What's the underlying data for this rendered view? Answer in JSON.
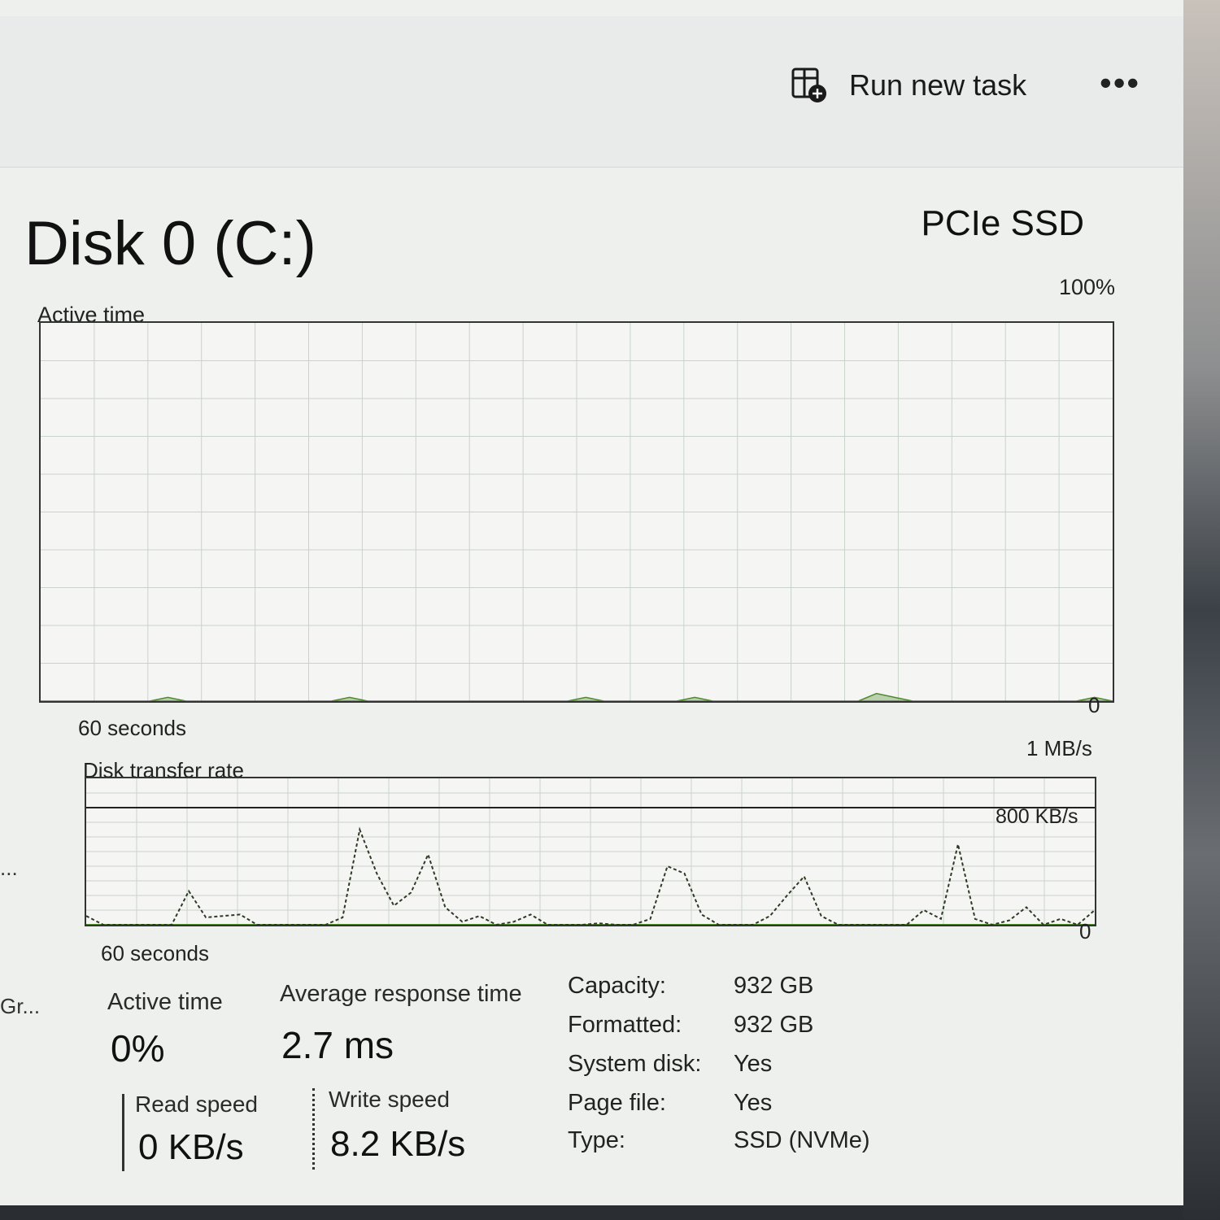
{
  "command_bar": {
    "run_task_label": "Run new task",
    "more_label": "•••"
  },
  "sidebar": {
    "ellipsis_text": "...",
    "gpu_label": "Gr..."
  },
  "disk": {
    "title": "Disk 0 (C:)",
    "model": "PCIe SSD"
  },
  "active_time_graph": {
    "label": "Active time",
    "max_label": "100%",
    "min_label": "0",
    "time_label": "60 seconds",
    "accent_color": "#4f8a2c"
  },
  "transfer_graph": {
    "label": "Disk transfer rate",
    "max_label": "1 MB/s",
    "ref_label": "800 KB/s",
    "min_label": "0",
    "time_label": "60 seconds",
    "accent_color": "#4f8a2c"
  },
  "stats": {
    "active_time_label": "Active time",
    "active_time_value": "0%",
    "avg_response_label": "Average response time",
    "avg_response_value": "2.7 ms",
    "read_speed_label": "Read speed",
    "read_speed_value": "0 KB/s",
    "write_speed_label": "Write speed",
    "write_speed_value": "8.2 KB/s"
  },
  "properties": [
    {
      "key": "Capacity:",
      "value": "932 GB"
    },
    {
      "key": "Formatted:",
      "value": "932 GB"
    },
    {
      "key": "System disk:",
      "value": "Yes"
    },
    {
      "key": "Page file:",
      "value": "Yes"
    },
    {
      "key": "Type:",
      "value": "SSD (NVMe)"
    }
  ],
  "chart_data": [
    {
      "type": "area",
      "title": "Active time",
      "xlabel": "60 seconds",
      "ylim": [
        0,
        100
      ],
      "unit": "%",
      "grid": true,
      "series": [
        {
          "values": [
            0,
            0,
            0,
            0,
            0,
            0,
            0,
            1,
            0,
            0,
            0,
            0,
            0,
            0,
            0,
            0,
            0,
            1,
            0,
            0,
            0,
            0,
            0,
            0,
            0,
            0,
            0,
            0,
            0,
            0,
            1,
            0,
            0,
            0,
            0,
            0,
            1,
            0,
            0,
            0,
            0,
            0,
            0,
            0,
            0,
            0,
            2,
            1,
            0,
            0,
            0,
            0,
            0,
            0,
            0,
            0,
            0,
            0,
            1,
            0
          ]
        }
      ]
    },
    {
      "type": "line",
      "title": "Disk transfer rate",
      "xlabel": "60 seconds",
      "ylim": [
        0,
        1000
      ],
      "unit": "KB/s",
      "reference_line": 800,
      "grid": true,
      "series": [
        {
          "name": "Read speed",
          "values": [
            0,
            0,
            0,
            0,
            0,
            0,
            0,
            0,
            0,
            0,
            0,
            0,
            0,
            0,
            0,
            0,
            0,
            0,
            0,
            0,
            0,
            0,
            0,
            0,
            0,
            0,
            0,
            0,
            0,
            0,
            0,
            0,
            0,
            0,
            0,
            0,
            0,
            0,
            0,
            0,
            0,
            0,
            0,
            0,
            0,
            0,
            0,
            0,
            0,
            0,
            0,
            0,
            0,
            0,
            0,
            0,
            0,
            0,
            0,
            0
          ]
        },
        {
          "name": "Write speed",
          "values": [
            60,
            0,
            0,
            0,
            0,
            0,
            230,
            50,
            60,
            70,
            0,
            0,
            0,
            0,
            0,
            50,
            650,
            350,
            130,
            220,
            480,
            120,
            20,
            60,
            0,
            20,
            70,
            0,
            0,
            0,
            10,
            0,
            0,
            40,
            400,
            350,
            70,
            0,
            0,
            0,
            60,
            200,
            330,
            60,
            0,
            0,
            0,
            0,
            0,
            100,
            40,
            550,
            40,
            0,
            30,
            120,
            0,
            40,
            0,
            100
          ]
        }
      ]
    }
  ]
}
